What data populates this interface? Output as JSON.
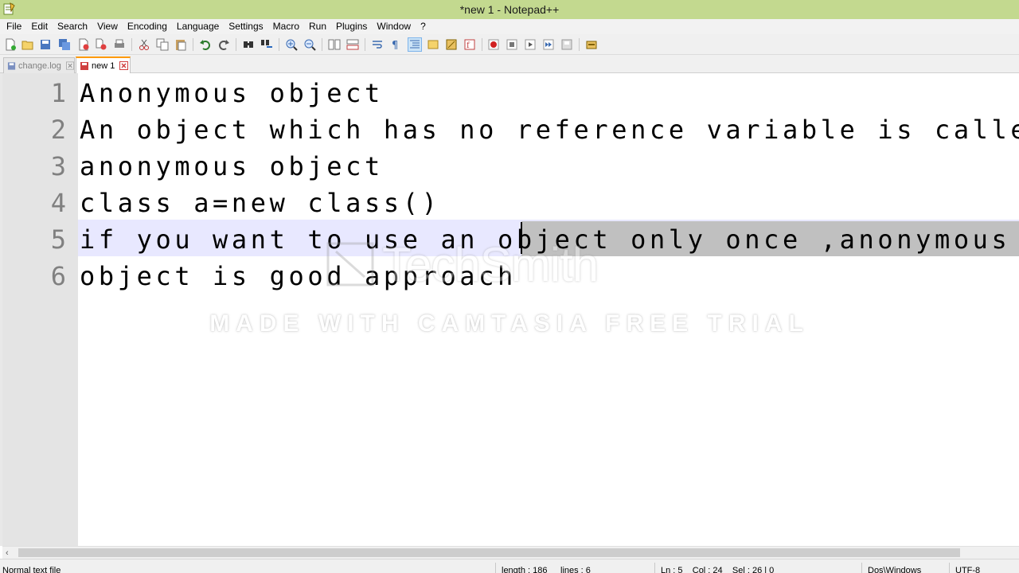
{
  "window": {
    "title": "*new 1 - Notepad++"
  },
  "menu": [
    "File",
    "Edit",
    "Search",
    "View",
    "Encoding",
    "Language",
    "Settings",
    "Macro",
    "Run",
    "Plugins",
    "Window",
    "?"
  ],
  "tabs": [
    {
      "label": "change.log",
      "active": false
    },
    {
      "label": "new 1",
      "active": true
    }
  ],
  "editor": {
    "lines": [
      {
        "number": "1",
        "text": "Anonymous object"
      },
      {
        "number": "2",
        "text": "An object which has no reference variable is called"
      },
      {
        "number": "3",
        "text": "anonymous object"
      },
      {
        "number": "4",
        "text": "class a=new class()"
      },
      {
        "number": "5",
        "text": "if you want to use an object only once ,anonymous"
      },
      {
        "number": "6",
        "text": "object is good approach"
      }
    ],
    "current_line": 5
  },
  "watermark": {
    "logo_text": "TechSmith",
    "trial_text": "MADE WITH CAMTASIA FREE TRIAL"
  },
  "status": {
    "file_type": "Normal text file",
    "length": "length : 186",
    "lines": "lines : 6",
    "position": "Ln : 5    Col : 24    Sel : 26 | 0",
    "eol": "Dos\\Windows",
    "encoding": "UTF-8"
  },
  "colors": {
    "titlebar": "#c3d98f",
    "current_line": "#e8e8ff",
    "selection": "#c0c0c0",
    "active_tab_accent": "#ff9a00"
  }
}
